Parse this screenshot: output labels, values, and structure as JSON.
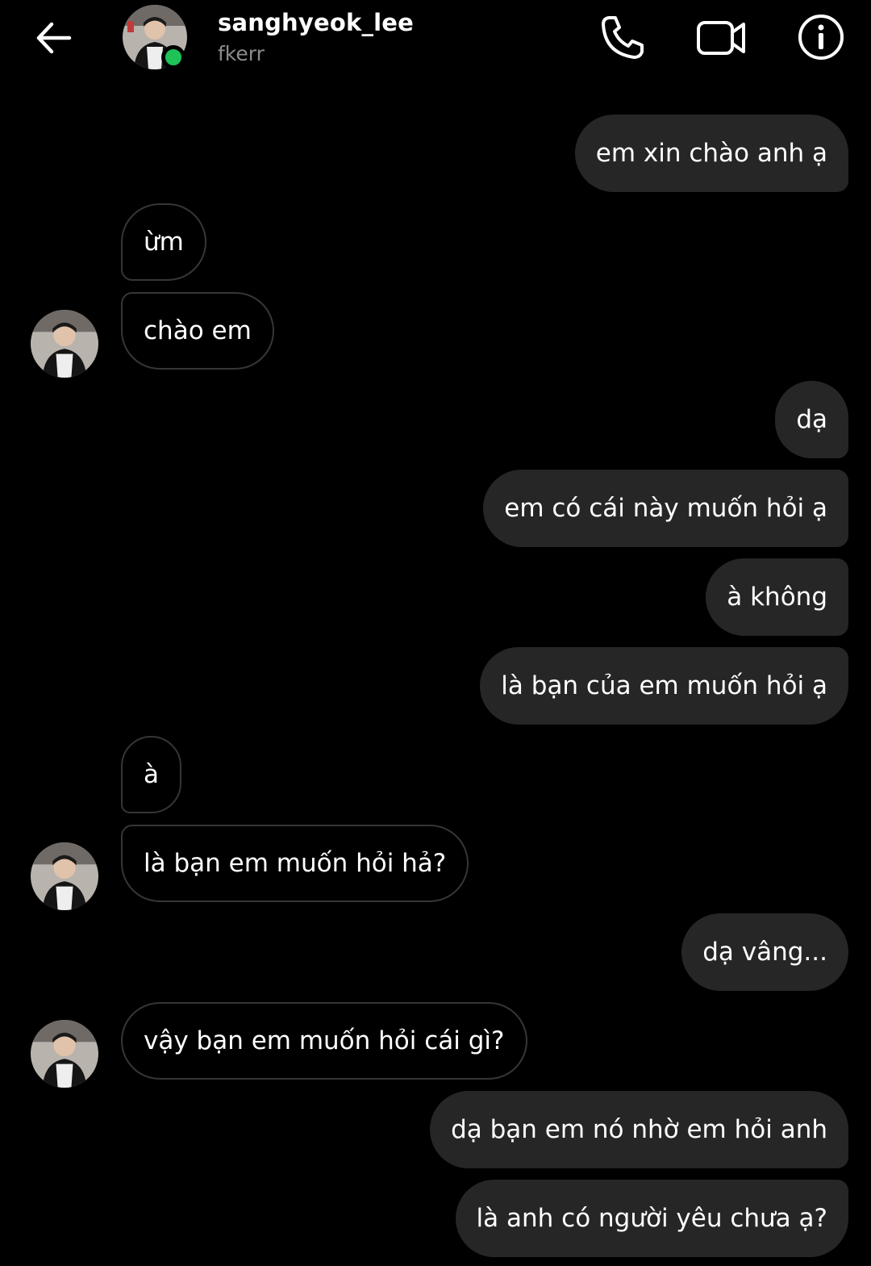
{
  "header": {
    "username": "sanghyeok_lee",
    "subtitle": "fkerr",
    "online_color": "#1fc257"
  },
  "messages": [
    {
      "sender": "me",
      "text": "em xin chào anh ạ"
    },
    {
      "sender": "them",
      "text": "ừm"
    },
    {
      "sender": "them",
      "text": "chào em"
    },
    {
      "sender": "me",
      "text": "dạ"
    },
    {
      "sender": "me",
      "text": "em có cái này muốn hỏi ạ"
    },
    {
      "sender": "me",
      "text": "à không"
    },
    {
      "sender": "me",
      "text": "là bạn của em muốn hỏi ạ"
    },
    {
      "sender": "them",
      "text": "à"
    },
    {
      "sender": "them",
      "text": "là bạn em muốn hỏi hả?"
    },
    {
      "sender": "me",
      "text": "dạ vâng..."
    },
    {
      "sender": "them",
      "text": "vậy bạn em muốn hỏi cái gì?"
    },
    {
      "sender": "me",
      "text": "dạ bạn em nó nhờ em hỏi anh"
    },
    {
      "sender": "me",
      "text": "là anh có người yêu chưa ạ?"
    }
  ],
  "colors": {
    "outgoing_bubble": "#262626",
    "incoming_border": "#363636",
    "background": "#000000"
  }
}
